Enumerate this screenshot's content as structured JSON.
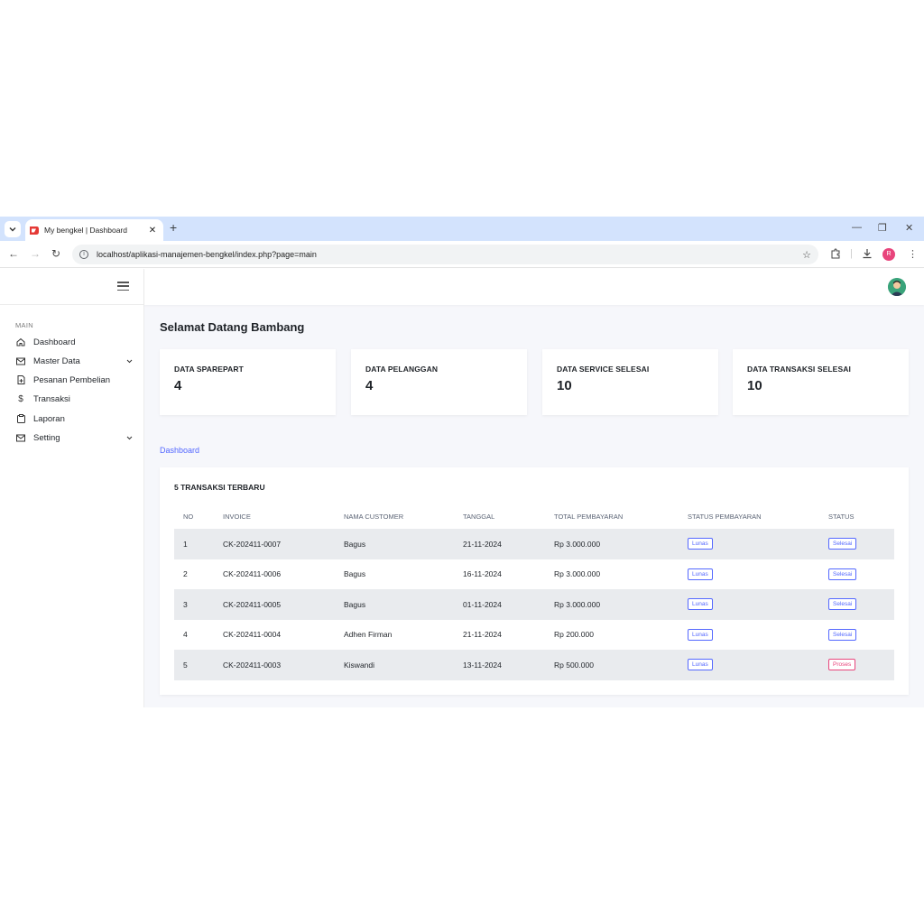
{
  "browser": {
    "tab_title": "My bengkel | Dashboard",
    "url": "localhost/aplikasi-manajemen-bengkel/index.php?page=main",
    "profile_initial": "R"
  },
  "sidebar": {
    "section_label": "MAIN",
    "items": [
      {
        "label": "Dashboard",
        "icon": "home-icon"
      },
      {
        "label": "Master Data",
        "icon": "mail-icon",
        "has_submenu": true
      },
      {
        "label": "Pesanan Pembelian",
        "icon": "file-plus-icon"
      },
      {
        "label": "Transaksi",
        "icon": "dollar-icon"
      },
      {
        "label": "Laporan",
        "icon": "clipboard-icon"
      },
      {
        "label": "Setting",
        "icon": "mail-icon",
        "has_submenu": true
      }
    ]
  },
  "main": {
    "welcome": "Selamat Datang Bambang",
    "stats": [
      {
        "label": "DATA SPAREPART",
        "value": "4"
      },
      {
        "label": "DATA PELANGGAN",
        "value": "4"
      },
      {
        "label": "DATA SERVICE SELESAI",
        "value": "10"
      },
      {
        "label": "DATA TRANSAKSI SELESAI",
        "value": "10"
      }
    ],
    "breadcrumb": "Dashboard",
    "table": {
      "title": "5 TRANSAKSI TERBARU",
      "columns": [
        "NO",
        "INVOICE",
        "NAMA CUSTOMER",
        "TANGGAL",
        "TOTAL PEMBAYARAN",
        "STATUS PEMBAYARAN",
        "STATUS"
      ],
      "rows": [
        {
          "no": "1",
          "invoice": "CK-202411-0007",
          "customer": "Bagus",
          "date": "21-11-2024",
          "total": "Rp 3.000.000",
          "payment_status": "Lunas",
          "status": "Selesai"
        },
        {
          "no": "2",
          "invoice": "CK-202411-0006",
          "customer": "Bagus",
          "date": "16-11-2024",
          "total": "Rp 3.000.000",
          "payment_status": "Lunas",
          "status": "Selesai"
        },
        {
          "no": "3",
          "invoice": "CK-202411-0005",
          "customer": "Bagus",
          "date": "01-11-2024",
          "total": "Rp 3.000.000",
          "payment_status": "Lunas",
          "status": "Selesai"
        },
        {
          "no": "4",
          "invoice": "CK-202411-0004",
          "customer": "Adhen Firman",
          "date": "21-11-2024",
          "total": "Rp 200.000",
          "payment_status": "Lunas",
          "status": "Selesai"
        },
        {
          "no": "5",
          "invoice": "CK-202411-0003",
          "customer": "Kiswandi",
          "date": "13-11-2024",
          "total": "Rp 500.000",
          "payment_status": "Lunas",
          "status": "Proses"
        }
      ]
    }
  },
  "colors": {
    "accent": "#5468ff",
    "danger": "#e8457c",
    "tabstrip": "#d3e3fd",
    "stripe": "#e9ebee"
  }
}
